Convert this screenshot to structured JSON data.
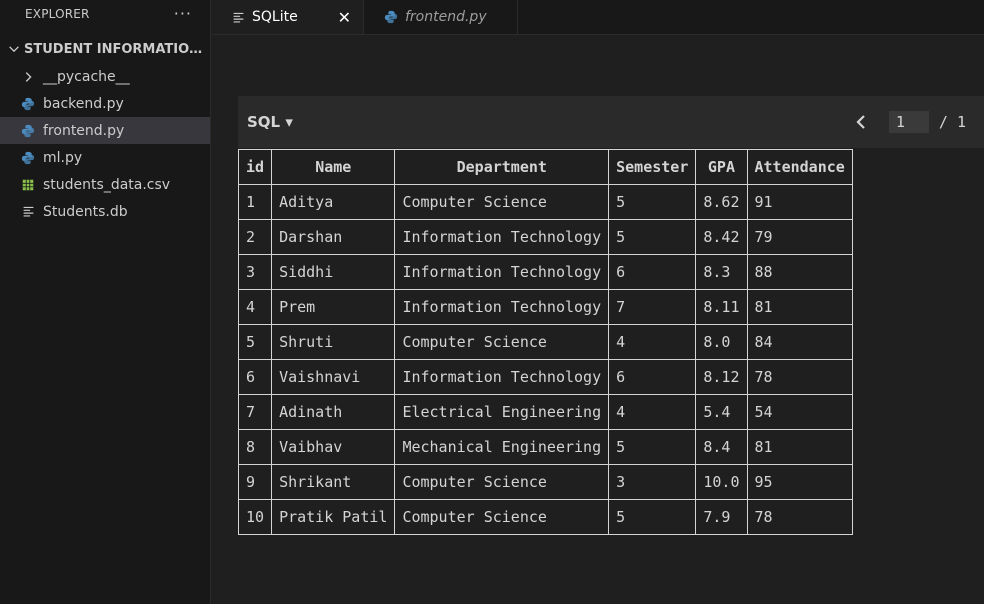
{
  "sidebar": {
    "title": "EXPLORER",
    "more": "···",
    "folder": "STUDENT INFORMATION ...",
    "items": [
      {
        "label": "__pycache__",
        "icon": "chevron-right-icon"
      },
      {
        "label": "backend.py",
        "icon": "python-icon"
      },
      {
        "label": "frontend.py",
        "icon": "python-icon",
        "selected": true
      },
      {
        "label": "ml.py",
        "icon": "python-icon"
      },
      {
        "label": "students_data.csv",
        "icon": "csv-icon"
      },
      {
        "label": "Students.db",
        "icon": "lines-icon"
      }
    ]
  },
  "tabs": [
    {
      "label": "SQLite",
      "icon": "lines-icon",
      "active": true,
      "close": "✕"
    },
    {
      "label": "frontend.py",
      "icon": "python-icon",
      "active": false
    }
  ],
  "toolbar": {
    "sql_label": "SQL ▾",
    "page_value": "1",
    "page_total": "/ 1"
  },
  "table": {
    "columns": [
      "id",
      "Name",
      "Department",
      "Semester",
      "GPA",
      "Attendance"
    ],
    "rows": [
      [
        "1",
        "Aditya",
        "Computer Science",
        "5",
        "8.62",
        "91"
      ],
      [
        "2",
        "Darshan",
        "Information Technology",
        "5",
        "8.42",
        "79"
      ],
      [
        "3",
        "Siddhi",
        "Information Technology",
        "6",
        "8.3",
        "88"
      ],
      [
        "4",
        "Prem",
        "Information Technology",
        "7",
        "8.11",
        "81"
      ],
      [
        "5",
        "Shruti",
        "Computer Science",
        "4",
        "8.0",
        "84"
      ],
      [
        "6",
        "Vaishnavi",
        "Information Technology",
        "6",
        "8.12",
        "78"
      ],
      [
        "7",
        "Adinath",
        "Electrical Engineering",
        "4",
        "5.4",
        "54"
      ],
      [
        "8",
        "Vaibhav",
        "Mechanical Engineering",
        "5",
        "8.4",
        "81"
      ],
      [
        "9",
        "Shrikant",
        "Computer Science",
        "3",
        "10.0",
        "95"
      ],
      [
        "10",
        "Pratik Patil",
        "Computer Science",
        "5",
        "7.9",
        "78"
      ]
    ]
  },
  "colors": {
    "python": "#4b8bbe",
    "csv": "#8bc34a",
    "selected": "#37373d"
  }
}
